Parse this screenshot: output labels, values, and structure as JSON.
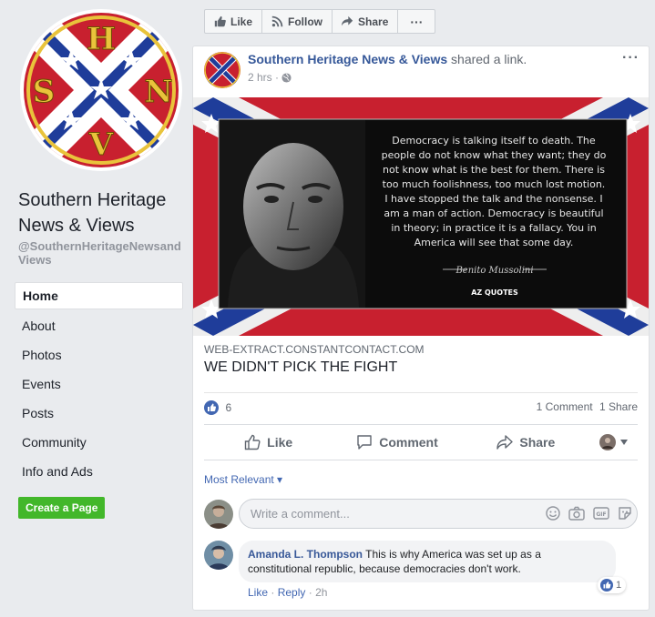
{
  "page": {
    "name": "Southern Heritage News & Views",
    "handle": "@SouthernHeritageNewsandViews",
    "logo_letters": {
      "top": "H",
      "left": "S",
      "right": "N",
      "bottom": "V"
    }
  },
  "nav": {
    "items": [
      "Home",
      "About",
      "Photos",
      "Events",
      "Posts",
      "Community",
      "Info and Ads"
    ],
    "create_page": "Create a Page"
  },
  "top_bar": {
    "like": "Like",
    "follow": "Follow",
    "share": "Share",
    "more": "···"
  },
  "post": {
    "author": "Southern Heritage News & Views",
    "action_text": "shared a",
    "action_link": "link.",
    "time": "2 hrs ·",
    "more": "···",
    "quote": {
      "lines": [
        "Democracy is talking itself to death. The",
        "people do not know what they want; they do",
        "not know what is the best for them. There is",
        "too much foolishness, too much lost motion.",
        "I have stopped the talk and the nonsense. I",
        "am a man of action. Democracy is beautiful",
        "in theory; in practice it is a fallacy. You in",
        "America will see that some day."
      ],
      "attribution": "Benito Mussolini",
      "brand": "AZ QUOTES"
    },
    "link_domain": "WEB-EXTRACT.CONSTANTCONTACT.COM",
    "link_title": "WE DIDN'T PICK THE FIGHT",
    "like_count": "6",
    "comment_count": "1 Comment",
    "share_count": "1 Share",
    "actions": {
      "like": "Like",
      "comment": "Comment",
      "share": "Share"
    },
    "sort_label": "Most Relevant ▾",
    "comment_placeholder": "Write a comment..."
  },
  "comment": {
    "author": "Amanda L. Thompson",
    "text": "This is why America was set up as a constitutional republic, because democracies don't work.",
    "reaction_count": "1",
    "like": "Like",
    "reply": "Reply",
    "time": "2h"
  },
  "colors": {
    "accent": "#4267b2",
    "link": "#365899",
    "create": "#42b72a",
    "flag_red": "#c8202f",
    "flag_blue": "#1f3d9a"
  }
}
